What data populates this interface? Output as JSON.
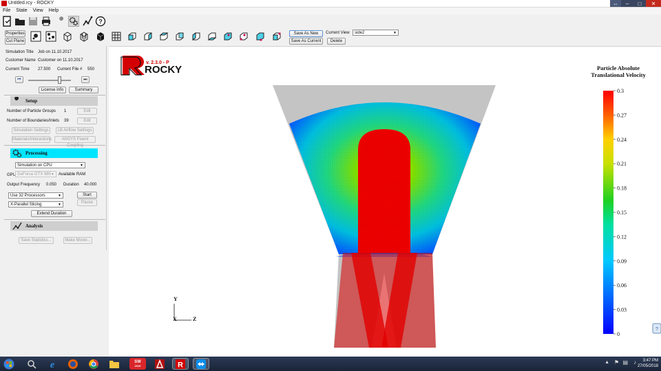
{
  "window": {
    "title": "Untitled.rcy - ROCKY",
    "colors": {
      "titlebar": "#ffffff",
      "close": "#c42b1c",
      "accent_processing": "#00e5ff"
    }
  },
  "menu": {
    "items": [
      "File",
      "State",
      "View",
      "Help"
    ]
  },
  "toolbar": {
    "icons": [
      "new-project-icon",
      "open-folder-icon",
      "save-icon",
      "print-icon",
      "wrench-icon",
      "processing-gears-icon",
      "analysis-curve-icon",
      "help-icon"
    ]
  },
  "panel_buttons": {
    "properties": "Properties",
    "cut_plane": "Cut Plane"
  },
  "view_tools": {
    "icons": [
      "particles-icon",
      "particle-group-icon",
      "wireframe-cube-icon",
      "mesh-cube-icon",
      "solid-cube-icon",
      "grid-icon",
      "cube-view-1-icon",
      "cube-view-2-icon",
      "cube-view-3-icon",
      "cube-view-4-icon",
      "cube-view-5-icon",
      "cube-view-6-icon",
      "cube-view-7-icon",
      "cube-view-8-icon",
      "cube-view-9-icon",
      "cube-view-10-icon"
    ]
  },
  "views": {
    "save_as_new": "Save As New",
    "save_as_current": "Save As Current",
    "current_view_label": "Current View",
    "current_view_value": "side2",
    "delete": "Delete"
  },
  "simulation": {
    "title_label": "Simulation Title",
    "title_value": "Job on 11.10.2017",
    "customer_label": "Customer Name",
    "customer_value": "Customer on 11.10.2017",
    "time_label": "Current Time",
    "time_value": "27.500",
    "file_label": "Current File #",
    "file_value": "550",
    "license_info": "License Info",
    "summary": "Summary"
  },
  "setup": {
    "header": "Setup",
    "groups_label": "Number of Particle Groups",
    "groups_value": "1",
    "boundaries_label": "Number of Boundaries/Inlets",
    "boundaries_value": "39",
    "edit": "Edit",
    "simulation_settings": "Simulation Settings",
    "lb_airflow": "LB Airflow Settings",
    "materials": "Materials/Interactions",
    "fluent": "ANSYS Fluent Coupling"
  },
  "processing": {
    "header": "Processing",
    "mode": "Simulation on CPU",
    "gpu_label": "GPU",
    "gpu_value": "GeForce GTX 980",
    "ram_label": "Available RAM",
    "output_freq_label": "Output Frequency",
    "output_freq_value": "0.050",
    "duration_label": "Duration",
    "duration_value": "40.000",
    "processors": "Use 32 Processors",
    "slicing": "X-Parallel Slicing",
    "start": "Start",
    "pause": "Pause",
    "extend": "Extend Duration"
  },
  "analysis": {
    "header": "Analysis",
    "save_statistics": "Save Statistics...",
    "make_movie": "Make Movie..."
  },
  "viewport": {
    "logo_text": "ROCKY",
    "logo_version": "v. 2.3.0 - P",
    "colorbar_title_1": "Particle Absolute",
    "colorbar_title_2": "Translational Velocity",
    "colorbar_ticks": [
      "0.3",
      "0.27",
      "0.24",
      "0.21",
      "0.18",
      "0.15",
      "0.12",
      "0.09",
      "0.06",
      "0.03",
      "0"
    ],
    "axis_y": "Y",
    "axis_x": "X",
    "axis_z": "Z"
  },
  "taskbar": {
    "apps": [
      "start-orb-icon",
      "search-icon",
      "internet-explorer-icon",
      "firefox-icon",
      "chrome-icon",
      "file-explorer-icon",
      "solidworks-icon",
      "ansys-icon",
      "rocky-icon",
      "teamviewer-icon"
    ],
    "sw_label": "SW",
    "sw_year": "2016",
    "time": "3:47 PM",
    "date": "27/05/2018"
  }
}
